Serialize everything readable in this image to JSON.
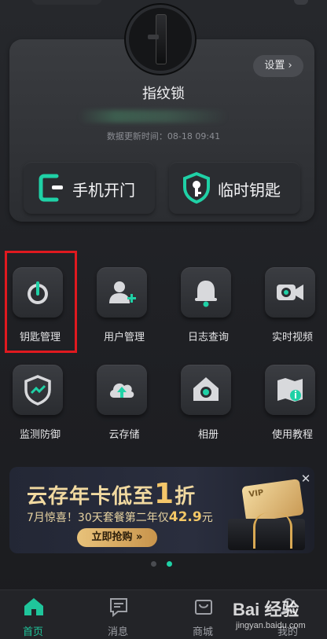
{
  "device": {
    "name": "指纹锁",
    "settings_label": "设置 ›",
    "update_time": "数据更新时间：08-18 09:41"
  },
  "actions": {
    "phone_unlock": "手机开门",
    "temp_key": "临时钥匙"
  },
  "grid": [
    {
      "label": "钥匙管理",
      "icon": "key-icon"
    },
    {
      "label": "用户管理",
      "icon": "add-user-icon"
    },
    {
      "label": "日志查询",
      "icon": "bell-icon"
    },
    {
      "label": "实时视频",
      "icon": "video-camera-icon"
    },
    {
      "label": "监测防御",
      "icon": "shield-chart-icon"
    },
    {
      "label": "云存储",
      "icon": "cloud-upload-icon"
    },
    {
      "label": "相册",
      "icon": "home-photo-icon"
    },
    {
      "label": "使用教程",
      "icon": "map-info-icon"
    }
  ],
  "banner": {
    "title_before": "云存年卡低至",
    "title_num": "1",
    "title_after": "折",
    "sub_before": "7月惊喜！30天套餐第二年仅",
    "sub_price": "42.9",
    "sub_after": "元",
    "button": "立即抢购 »",
    "vip": "VIP",
    "close": "✕"
  },
  "nav": {
    "home": "首页",
    "messages": "消息",
    "mall": "商城",
    "profile": "我的"
  },
  "watermark": {
    "main": "Bai 经验",
    "sub": "jingyan.baidu.com"
  },
  "colors": {
    "accent": "#1fd1a6",
    "highlight_box": "#e0191f",
    "gold": "#f3c766"
  }
}
